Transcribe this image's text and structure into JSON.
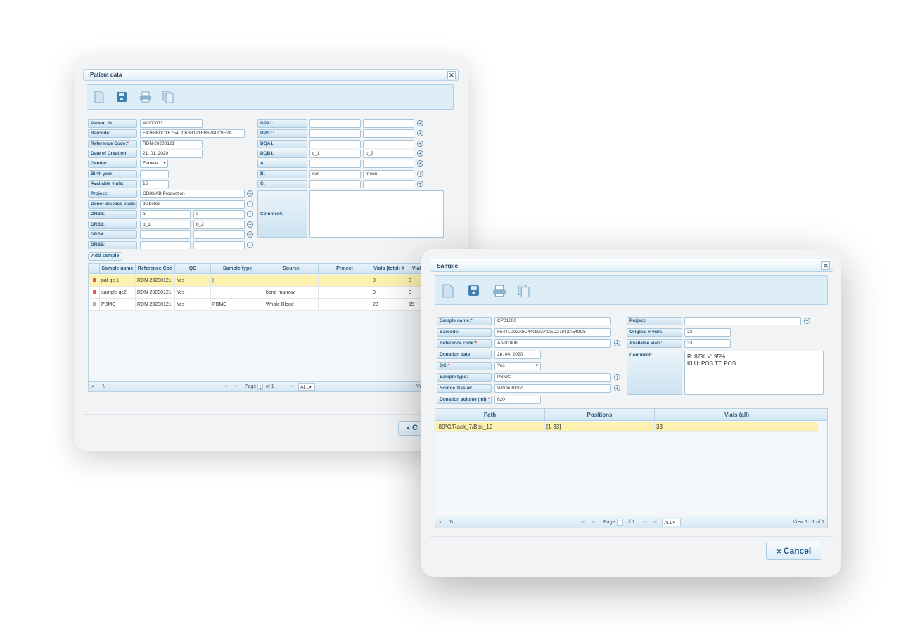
{
  "patient_window": {
    "title": "Patient data",
    "toolbar": [
      "new-icon",
      "save-icon",
      "print-icon",
      "copy-icon"
    ],
    "fields_left": [
      {
        "label": "Patient ID:",
        "value": "A/V00033",
        "required": false
      },
      {
        "label": "Barcode:",
        "value": "FA2886DC1E754DC6B8121EB62A0C9F2A",
        "required": false
      },
      {
        "label": "Reference Code:",
        "value": "RDN-20200121",
        "required": true
      },
      {
        "label": "Date of Creation:",
        "value": "21. 01. 2020",
        "required": false
      },
      {
        "label": "Gender:",
        "value": "Female",
        "required": false
      },
      {
        "label": "Birth year:",
        "value": "",
        "required": false
      },
      {
        "label": "Available vials:",
        "value": "15",
        "required": false
      },
      {
        "label": "Project:",
        "value": "CD83 AB Production",
        "required": false
      },
      {
        "label": "Donor disease state:",
        "value": "diabetes",
        "required": false
      }
    ],
    "drb_fields": [
      {
        "label": "DRB1:",
        "v1": "a",
        "v2": "c"
      },
      {
        "label": "DRB3:",
        "v1": "b_1",
        "v2": "b_2"
      },
      {
        "label": "DRB4:",
        "v1": "",
        "v2": ""
      },
      {
        "label": "DRB5:",
        "v1": "",
        "v2": ""
      }
    ],
    "fields_right": [
      {
        "label": "DPA1:",
        "v1": "",
        "v2": ""
      },
      {
        "label": "DPB1:",
        "v1": "",
        "v2": ""
      },
      {
        "label": "DQA1:",
        "v1": "",
        "v2": ""
      },
      {
        "label": "DQB1:",
        "v1": "c_1",
        "v2": "c_2"
      },
      {
        "label": "A:",
        "v1": "",
        "v2": ""
      },
      {
        "label": "B:",
        "v1": "sun",
        "v2": "moon"
      },
      {
        "label": "C:",
        "v1": "",
        "v2": ""
      }
    ],
    "comment_label": "Comment:",
    "comment_value": "",
    "add_sample_label": "Add sample",
    "columns": [
      "",
      "Sample name",
      "Reference Cod",
      "QC",
      "Sample type",
      "Source",
      "Project",
      "Vials (total) #",
      "Vials"
    ],
    "rows": [
      {
        "lock": "red",
        "name": "pat qc 1",
        "ref": "RDN-20200121",
        "qc": "Yes",
        "type": "|",
        "source": "",
        "project": "",
        "total": "0",
        "vials": "0",
        "selected": true
      },
      {
        "lock": "red",
        "name": "sample qc2",
        "ref": "RDN-20200121",
        "qc": "Yes",
        "type": "",
        "source": "bone marrow",
        "project": "",
        "total": "0",
        "vials": "0",
        "selected": false
      },
      {
        "lock": "gray",
        "name": "PBMC",
        "ref": "RDN-20200121",
        "qc": "Yes",
        "type": "PBMC",
        "source": "Whole Blood",
        "project": "",
        "total": "23",
        "vials": "15",
        "selected": false
      }
    ],
    "pager": {
      "page_label": "Page",
      "page": "1",
      "of_label": "of 1",
      "per_page": "ALL",
      "view": "Vi"
    },
    "cancel_label": "C"
  },
  "sample_window": {
    "title": "Sample",
    "toolbar": [
      "new-icon",
      "save-icon",
      "print-icon",
      "copy-icon"
    ],
    "fields_left": [
      {
        "label": "Sample name:",
        "value": "CP01000",
        "required": true,
        "plus": false
      },
      {
        "label": "Barcode:",
        "value": "F5441D93A6C440B2AACEC27842A549C6",
        "required": false,
        "plus": false
      },
      {
        "label": "Reference code:",
        "value": "A/V01000",
        "required": true,
        "plus": true
      },
      {
        "label": "Donation date:",
        "value": "28. 04. 2020",
        "required": false,
        "plus": false
      },
      {
        "label": "QC:",
        "value": "Yes",
        "required": true,
        "plus": false
      },
      {
        "label": "Sample type:",
        "value": "PBMC",
        "required": false,
        "plus": true
      },
      {
        "label": "Source Tissue:",
        "value": "Whole Blood",
        "required": false,
        "plus": true
      },
      {
        "label": "Donation volume (ml):",
        "value": "620",
        "required": true,
        "plus": false
      }
    ],
    "fields_right": [
      {
        "label": "Project:",
        "value": ""
      },
      {
        "label": "Original # vials:",
        "value": "33"
      },
      {
        "label": "Available vials:",
        "value": "33"
      }
    ],
    "comment_label": "Comment:",
    "comment_line1": "R: 87% V: 95%",
    "comment_line2": "KLH: POS TT: POS",
    "columns": [
      "Path",
      "Positions",
      "Vials (all)"
    ],
    "rows": [
      {
        "path": "-80°C/Rack_7/Box_12",
        "positions": "[1-33]",
        "vials": "33"
      }
    ],
    "pager": {
      "page_label": "Page",
      "page": "1",
      "of_label": "of 1",
      "per_page": "ALL",
      "view": "View 1 - 1 of 1"
    },
    "cancel_label": "Cancel"
  }
}
